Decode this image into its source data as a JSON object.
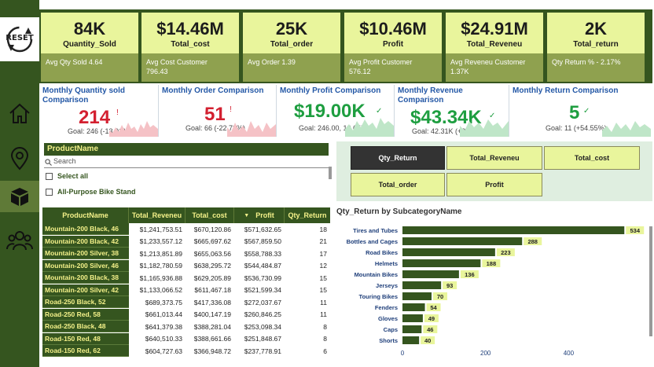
{
  "sidebar": {
    "reset_label": "RESET",
    "items": [
      {
        "icon": "reset-icon"
      },
      {
        "icon": "home-icon"
      },
      {
        "icon": "location-pin-icon"
      },
      {
        "icon": "box-icon"
      },
      {
        "icon": "users-icon"
      }
    ]
  },
  "kpis": [
    {
      "value": "84K",
      "label": "Quantity_Sold",
      "sub": "Avg Qty Sold 4.64"
    },
    {
      "value": "$14.46M",
      "label": "Total_cost",
      "sub": "Avg Cost Customer\n796.43"
    },
    {
      "value": "25K",
      "label": "Total_order",
      "sub": "Avg Order 1.39"
    },
    {
      "value": "$10.46M",
      "label": "Profit",
      "sub": "Avg Profit Customer\n576.12"
    },
    {
      "value": "$24.91M",
      "label": "Total_Reveneu",
      "sub": "Avg Reveneu Customer\n1.37K"
    },
    {
      "value": "2K",
      "label": "Total_return",
      "sub": "Qty Return % - 2.17%"
    }
  ],
  "comparisons": [
    {
      "title": "Monthly Quantity sold Comparison",
      "value": "214",
      "mark": "!",
      "goal": "Goal: 246 (-13.01%)",
      "status": "bad"
    },
    {
      "title": "Monthly Order Comparison",
      "value": "51",
      "mark": "!",
      "goal": "Goal: 66 (-22.73%)",
      "status": "bad"
    },
    {
      "title": "Monthly Profit Comparison",
      "value": "$19.00K",
      "mark": "✓",
      "goal": "Goal: 246.00, 18.65K",
      "status": "good"
    },
    {
      "title": "Monthly Revenue Comparison",
      "value": "$43.34K",
      "mark": "✓",
      "goal": "Goal: 42.31K (+2.44%)",
      "status": "good"
    },
    {
      "title": "Monthly Return Comparison",
      "value": "5",
      "mark": "✓",
      "goal": "Goal: 11 (+54.55%)",
      "status": "good"
    }
  ],
  "slicer": {
    "header": "ProductName",
    "search_placeholder": "Search",
    "items": [
      "Select all",
      "All-Purpose Bike Stand"
    ]
  },
  "table": {
    "columns": [
      "ProductName",
      "Total_Reveneu",
      "Total_cost",
      "Profit",
      "Qty_Return"
    ],
    "rows": [
      [
        "Mountain-200 Black, 46",
        "$1,241,753.51",
        "$670,120.86",
        "$571,632.65",
        "18"
      ],
      [
        "Mountain-200 Black, 42",
        "$1,233,557.12",
        "$665,697.62",
        "$567,859.50",
        "21"
      ],
      [
        "Mountain-200 Silver, 38",
        "$1,213,851.89",
        "$655,063.56",
        "$558,788.33",
        "17"
      ],
      [
        "Mountain-200 Silver, 46",
        "$1,182,780.59",
        "$638,295.72",
        "$544,484.87",
        "12"
      ],
      [
        "Mountain-200 Black, 38",
        "$1,165,936.88",
        "$629,205.89",
        "$536,730.99",
        "15"
      ],
      [
        "Mountain-200 Silver, 42",
        "$1,133,066.52",
        "$611,467.18",
        "$521,599.34",
        "15"
      ],
      [
        "Road-250 Black, 52",
        "$689,373.75",
        "$417,336.08",
        "$272,037.67",
        "11"
      ],
      [
        "Road-250 Red, 58",
        "$661,013.44",
        "$400,147.19",
        "$260,846.25",
        "11"
      ],
      [
        "Road-250 Black, 48",
        "$641,379.38",
        "$388,281.04",
        "$253,098.34",
        "8"
      ],
      [
        "Road-150 Red, 48",
        "$640,510.33",
        "$388,661.66",
        "$251,848.67",
        "8"
      ],
      [
        "Road-150 Red, 62",
        "$604,727.63",
        "$366,948.72",
        "$237,778.91",
        "6"
      ]
    ]
  },
  "metric_buttons": [
    {
      "label": "Qty_Return",
      "selected": true
    },
    {
      "label": "Total_Reveneu",
      "selected": false
    },
    {
      "label": "Total_cost",
      "selected": false
    },
    {
      "label": "Total_order",
      "selected": false
    },
    {
      "label": "Profit",
      "selected": false
    }
  ],
  "colors": {
    "dark_green": "#35551f",
    "light_yellow": "#e9f59c",
    "olive": "#8fa14f",
    "bad_red": "#d32030",
    "good_green": "#1e9e40"
  },
  "chart_data": {
    "type": "bar",
    "orientation": "horizontal",
    "title": "Qty_Return by SubcategoryName",
    "categories": [
      "Tires and Tubes",
      "Bottles and Cages",
      "Road Bikes",
      "Helmets",
      "Mountain Bikes",
      "Jerseys",
      "Touring Bikes",
      "Fenders",
      "Gloves",
      "Caps",
      "Shorts"
    ],
    "values": [
      534,
      288,
      223,
      188,
      136,
      93,
      70,
      54,
      49,
      46,
      40
    ],
    "x_ticks": [
      "0",
      "200",
      "400"
    ],
    "xlim": [
      0,
      560
    ],
    "bar_color": "#35551f",
    "label_bg": "#e9f59c"
  }
}
